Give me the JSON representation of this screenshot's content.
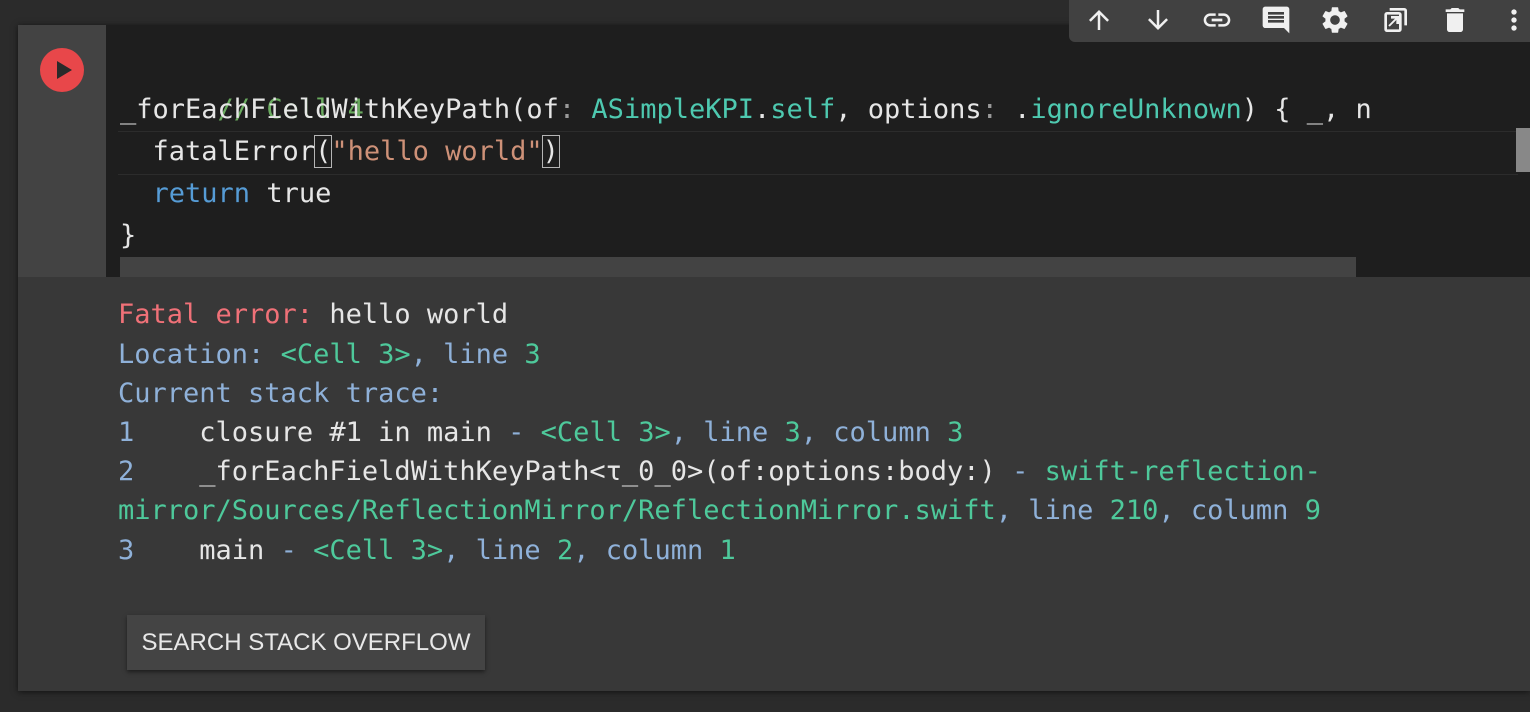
{
  "toolbar": {
    "icons": [
      "arrow-up-icon",
      "arrow-down-icon",
      "link-icon",
      "comment-icon",
      "gear-icon",
      "mirror-cell-icon",
      "delete-icon",
      "more-vert-icon"
    ]
  },
  "cell": {
    "code_lines": [
      {
        "comment": "// Cell 4"
      },
      {
        "func": "_forEachFieldWithKeyPath(of",
        "colon1": ":",
        "type": " ASimpleKPI",
        "dot": ".",
        "self": "self",
        "rest1": ", options",
        "colon2": ":",
        "dot2": " .",
        "enum": "ignoreUnknown",
        "rest2": ") { _, n"
      },
      {
        "indent": "  ",
        "fn": "fatalError",
        "open": "(",
        "str": "\"hello world\"",
        "close": ")"
      },
      {
        "indent": "  ",
        "kw": "return",
        "rest": " true"
      },
      {
        "brace": "}"
      }
    ]
  },
  "output": {
    "line1": {
      "label": "Fatal error:",
      "text": " hello world"
    },
    "line2": {
      "label": "Location: ",
      "loc": "<Cell 3>",
      "rest": ", line ",
      "num": "3"
    },
    "line3": {
      "label": "Current stack trace:"
    },
    "line4": {
      "idx": "1",
      "fn": "    closure #1 in main",
      "sep": " - ",
      "loc": "<Cell 3>",
      "rest": ", line ",
      "n1": "3",
      "rest2": ", column ",
      "n2": "3"
    },
    "line5": {
      "idx": "2",
      "fn": "    _forEachFieldWithKeyPath<τ_0_0>(of:options:body:)",
      "sep": " - ",
      "loc": "swift-reflection-"
    },
    "line6": {
      "loc": "mirror/Sources/ReflectionMirror/ReflectionMirror.swift",
      "rest": ", line ",
      "n1": "210",
      "rest2": ", column ",
      "n2": "9"
    },
    "line7": {
      "idx": "3",
      "fn": "    main",
      "sep": " - ",
      "loc": "<Cell 3>",
      "rest": ", line ",
      "n1": "2",
      "rest2": ", column ",
      "n2": "1"
    }
  },
  "search_button": {
    "label": "SEARCH STACK OVERFLOW"
  }
}
